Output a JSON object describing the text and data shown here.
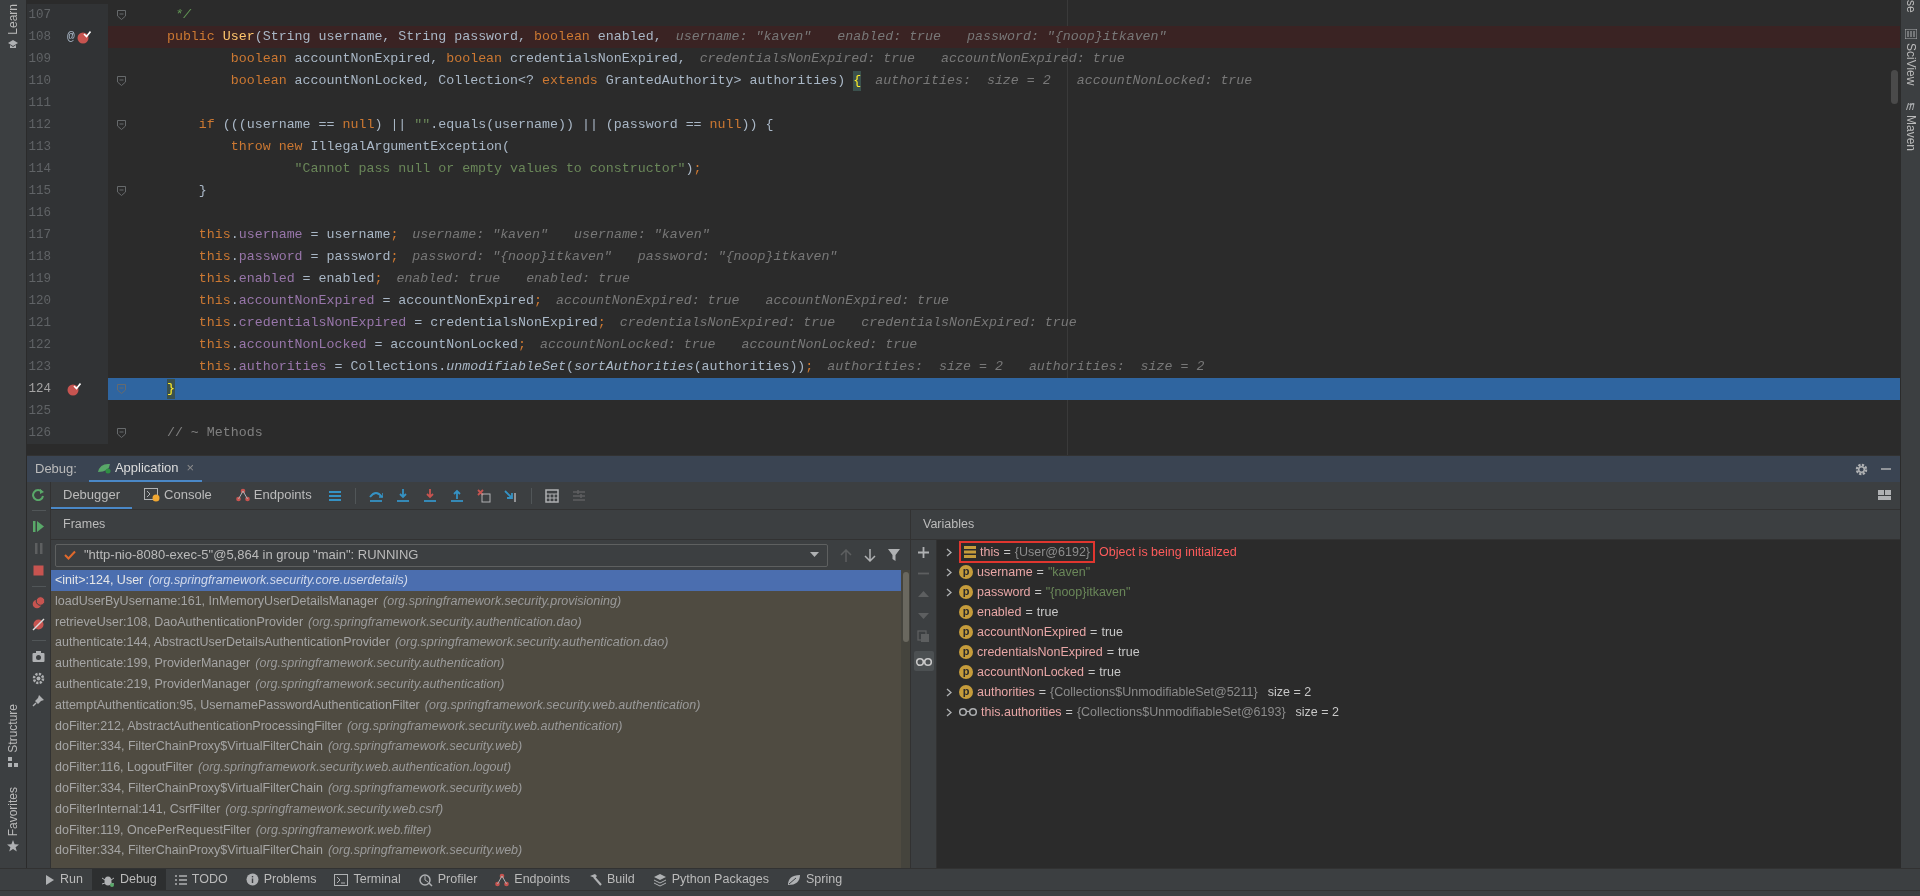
{
  "left_strip": [
    {
      "label": "Learn"
    },
    {
      "label": "Structure"
    },
    {
      "label": "Favorites"
    }
  ],
  "right_strip": [
    {
      "label": "se"
    },
    {
      "label": "SciView"
    },
    {
      "label": "Maven"
    }
  ],
  "editor": {
    "lines": [
      {
        "number": "107",
        "fold": true,
        "breakpoint": false,
        "current": false,
        "tokens": [
          {
            "t": "     */",
            "kind": "doc"
          }
        ]
      },
      {
        "number": "108",
        "mark": "@",
        "fold": false,
        "breakpoint": true,
        "current": false,
        "tokens": [
          {
            "t": "    public ",
            "kind": "kw"
          },
          {
            "t": "User",
            "kind": "fn"
          },
          {
            "t": "(String username, String password, ",
            "kind": "plain"
          },
          {
            "t": "boolean",
            "kind": "kw"
          },
          {
            "t": " enabled,",
            "kind": "plain"
          }
        ],
        "hints": [
          "username: \"kaven\"",
          "enabled: true",
          "password: \"{noop}itkaven\""
        ]
      },
      {
        "number": "109",
        "fold": false,
        "breakpoint": false,
        "current": false,
        "tokens": [
          {
            "t": "            boolean",
            "kind": "kw"
          },
          {
            "t": " accountNonExpired, ",
            "kind": "plain"
          },
          {
            "t": "boolean",
            "kind": "kw"
          },
          {
            "t": " credentialsNonExpired,",
            "kind": "plain"
          }
        ],
        "hints": [
          "credentialsNonExpired: true",
          "accountNonExpired: true"
        ]
      },
      {
        "number": "110",
        "fold": true,
        "breakpoint": false,
        "current": false,
        "tokens": [
          {
            "t": "            boolean",
            "kind": "kw"
          },
          {
            "t": " accountNonLocked, Collection<? ",
            "kind": "plain"
          },
          {
            "t": "extends",
            "kind": "kw"
          },
          {
            "t": " GrantedAuthority> authorities) ",
            "kind": "plain"
          },
          {
            "t": "{",
            "kind": "brace"
          }
        ],
        "hints": [
          "authorities:  size = 2",
          "accountNonLocked: true"
        ]
      },
      {
        "number": "111",
        "fold": false,
        "breakpoint": false,
        "current": false
      },
      {
        "number": "112",
        "fold": true,
        "breakpoint": false,
        "current": false,
        "tokens": [
          {
            "t": "        if",
            "kind": "kw"
          },
          {
            "t": " (((username == ",
            "kind": "plain"
          },
          {
            "t": "null",
            "kind": "kw"
          },
          {
            "t": ") || ",
            "kind": "plain"
          },
          {
            "t": "\"\"",
            "kind": "str"
          },
          {
            "t": ".equals(username)) || (password == ",
            "kind": "plain"
          },
          {
            "t": "null",
            "kind": "kw"
          },
          {
            "t": ")) {",
            "kind": "plain"
          }
        ]
      },
      {
        "number": "113",
        "fold": false,
        "breakpoint": false,
        "current": false,
        "tokens": [
          {
            "t": "            throw new",
            "kind": "kw"
          },
          {
            "t": " IllegalArgumentException(",
            "kind": "plain"
          }
        ]
      },
      {
        "number": "114",
        "fold": false,
        "breakpoint": false,
        "current": false,
        "tokens": [
          {
            "t": "                    \"Cannot pass null or empty values to constructor\"",
            "kind": "str"
          },
          {
            "t": ")",
            "kind": "plain"
          },
          {
            "t": ";",
            "kind": "kw"
          }
        ]
      },
      {
        "number": "115",
        "fold": true,
        "breakpoint": false,
        "current": false,
        "tokens": [
          {
            "t": "        }",
            "kind": "plain"
          }
        ]
      },
      {
        "number": "116",
        "fold": false,
        "breakpoint": false,
        "current": false
      },
      {
        "number": "117",
        "fold": false,
        "breakpoint": false,
        "current": false,
        "tokens": [
          {
            "t": "        this",
            "kind": "kw"
          },
          {
            "t": ".",
            "kind": "plain"
          },
          {
            "t": "username",
            "kind": "field"
          },
          {
            "t": " = username",
            "kind": "plain"
          },
          {
            "t": ";",
            "kind": "kw"
          }
        ],
        "hints": [
          "username: \"kaven\"",
          "username: \"kaven\""
        ]
      },
      {
        "number": "118",
        "fold": false,
        "breakpoint": false,
        "current": false,
        "tokens": [
          {
            "t": "        this",
            "kind": "kw"
          },
          {
            "t": ".",
            "kind": "plain"
          },
          {
            "t": "password",
            "kind": "field"
          },
          {
            "t": " = password",
            "kind": "plain"
          },
          {
            "t": ";",
            "kind": "kw"
          }
        ],
        "hints": [
          "password: \"{noop}itkaven\"",
          "password: \"{noop}itkaven\""
        ]
      },
      {
        "number": "119",
        "fold": false,
        "breakpoint": false,
        "current": false,
        "tokens": [
          {
            "t": "        this",
            "kind": "kw"
          },
          {
            "t": ".",
            "kind": "plain"
          },
          {
            "t": "enabled",
            "kind": "field"
          },
          {
            "t": " = enabled",
            "kind": "plain"
          },
          {
            "t": ";",
            "kind": "kw"
          }
        ],
        "hints": [
          "enabled: true",
          "enabled: true"
        ]
      },
      {
        "number": "120",
        "fold": false,
        "breakpoint": false,
        "current": false,
        "tokens": [
          {
            "t": "        this",
            "kind": "kw"
          },
          {
            "t": ".",
            "kind": "plain"
          },
          {
            "t": "accountNonExpired",
            "kind": "field"
          },
          {
            "t": " = accountNonExpired",
            "kind": "plain"
          },
          {
            "t": ";",
            "kind": "kw"
          }
        ],
        "hints": [
          "accountNonExpired: true",
          "accountNonExpired: true"
        ]
      },
      {
        "number": "121",
        "fold": false,
        "breakpoint": false,
        "current": false,
        "tokens": [
          {
            "t": "        this",
            "kind": "kw"
          },
          {
            "t": ".",
            "kind": "plain"
          },
          {
            "t": "credentialsNonExpired",
            "kind": "field"
          },
          {
            "t": " = credentialsNonExpired",
            "kind": "plain"
          },
          {
            "t": ";",
            "kind": "kw"
          }
        ],
        "hints": [
          "credentialsNonExpired: true",
          "credentialsNonExpired: true"
        ]
      },
      {
        "number": "122",
        "fold": false,
        "breakpoint": false,
        "current": false,
        "tokens": [
          {
            "t": "        this",
            "kind": "kw"
          },
          {
            "t": ".",
            "kind": "plain"
          },
          {
            "t": "accountNonLocked",
            "kind": "field"
          },
          {
            "t": " = accountNonLocked",
            "kind": "plain"
          },
          {
            "t": ";",
            "kind": "kw"
          }
        ],
        "hints": [
          "accountNonLocked: true",
          "accountNonLocked: true"
        ]
      },
      {
        "number": "123",
        "fold": false,
        "breakpoint": false,
        "current": false,
        "tokens": [
          {
            "t": "        this",
            "kind": "kw"
          },
          {
            "t": ".",
            "kind": "plain"
          },
          {
            "t": "authorities",
            "kind": "field"
          },
          {
            "t": " = Collections.",
            "kind": "plain"
          },
          {
            "t": "unmodifiableSet",
            "kind": "italic"
          },
          {
            "t": "(",
            "kind": "plain"
          },
          {
            "t": "sortAuthorities",
            "kind": "italic"
          },
          {
            "t": "(authorities))",
            "kind": "plain"
          },
          {
            "t": ";",
            "kind": "kw"
          }
        ],
        "hints": [
          "authorities:  size = 2",
          "authorities:  size = 2"
        ]
      },
      {
        "number": "124",
        "fold": true,
        "breakpoint": true,
        "current": true,
        "tokens": [
          {
            "t": "    }",
            "kind": "brace"
          }
        ]
      },
      {
        "number": "125",
        "fold": false,
        "breakpoint": false,
        "current": false
      },
      {
        "number": "126",
        "fold": true,
        "breakpoint": false,
        "current": false,
        "tokens": [
          {
            "t": "    // ~ Methods",
            "kind": "comment"
          }
        ]
      }
    ]
  },
  "debug": {
    "title": "Debug:",
    "session": {
      "label": "Application",
      "selected": true,
      "close": "×"
    },
    "tabs": [
      {
        "label": "Debugger",
        "selected": true
      },
      {
        "label": "Console",
        "selected": false
      },
      {
        "label": "Endpoints",
        "selected": false
      }
    ],
    "frames": {
      "title": "Frames",
      "thread": "\"http-nio-8080-exec-5\"@5,864 in group \"main\": RUNNING",
      "items": [
        {
          "method": "<init>:124, User",
          "package": "(org.springframework.security.core.userdetails)",
          "selected": true
        },
        {
          "method": "loadUserByUsername:161, InMemoryUserDetailsManager",
          "package": "(org.springframework.security.provisioning)",
          "selected": false
        },
        {
          "method": "retrieveUser:108, DaoAuthenticationProvider",
          "package": "(org.springframework.security.authentication.dao)",
          "selected": false
        },
        {
          "method": "authenticate:144, AbstractUserDetailsAuthenticationProvider",
          "package": "(org.springframework.security.authentication.dao)",
          "selected": false
        },
        {
          "method": "authenticate:199, ProviderManager",
          "package": "(org.springframework.security.authentication)",
          "selected": false
        },
        {
          "method": "authenticate:219, ProviderManager",
          "package": "(org.springframework.security.authentication)",
          "selected": false
        },
        {
          "method": "attemptAuthentication:95, UsernamePasswordAuthenticationFilter",
          "package": "(org.springframework.security.web.authentication)",
          "selected": false
        },
        {
          "method": "doFilter:212, AbstractAuthenticationProcessingFilter",
          "package": "(org.springframework.security.web.authentication)",
          "selected": false
        },
        {
          "method": "doFilter:334, FilterChainProxy$VirtualFilterChain",
          "package": "(org.springframework.security.web)",
          "selected": false
        },
        {
          "method": "doFilter:116, LogoutFilter",
          "package": "(org.springframework.security.web.authentication.logout)",
          "selected": false
        },
        {
          "method": "doFilter:334, FilterChainProxy$VirtualFilterChain",
          "package": "(org.springframework.security.web)",
          "selected": false
        },
        {
          "method": "doFilterInternal:141, CsrfFilter",
          "package": "(org.springframework.security.web.csrf)",
          "selected": false
        },
        {
          "method": "doFilter:119, OncePerRequestFilter",
          "package": "(org.springframework.web.filter)",
          "selected": false
        },
        {
          "method": "doFilter:334, FilterChainProxy$VirtualFilterChain",
          "package": "(org.springframework.security.web)",
          "selected": false
        }
      ]
    },
    "variables": {
      "title": "Variables",
      "items": [
        {
          "kind": "object",
          "expandable": true,
          "boxed": true,
          "name": "this",
          "op": "=",
          "value": {
            "text": "{User@6192}",
            "kind": "ref"
          },
          "note": "Object is being initialized"
        },
        {
          "kind": "param",
          "badge": "p",
          "expandable": true,
          "boxed": false,
          "name": "username",
          "op": "=",
          "value": {
            "text": "\"kaven\"",
            "kind": "string"
          }
        },
        {
          "kind": "param",
          "badge": "p",
          "expandable": true,
          "boxed": false,
          "name": "password",
          "op": "=",
          "value": {
            "text": "\"{noop}itkaven\"",
            "kind": "string"
          }
        },
        {
          "kind": "param",
          "badge": "p",
          "expandable": false,
          "boxed": false,
          "name": "enabled",
          "op": "=",
          "value": {
            "text": "true",
            "kind": "literal"
          }
        },
        {
          "kind": "param",
          "badge": "p",
          "expandable": false,
          "boxed": false,
          "name": "accountNonExpired",
          "op": "=",
          "value": {
            "text": "true",
            "kind": "literal"
          }
        },
        {
          "kind": "param",
          "badge": "p",
          "expandable": false,
          "boxed": false,
          "name": "credentialsNonExpired",
          "op": "=",
          "value": {
            "text": "true",
            "kind": "literal"
          }
        },
        {
          "kind": "param",
          "badge": "p",
          "expandable": false,
          "boxed": false,
          "name": "accountNonLocked",
          "op": "=",
          "value": {
            "text": "true",
            "kind": "literal"
          }
        },
        {
          "kind": "param",
          "badge": "p",
          "expandable": true,
          "boxed": false,
          "name": "authorities",
          "op": "=",
          "value": {
            "text": "{Collections$UnmodifiableSet@5211}",
            "kind": "ref"
          },
          "extra": "size = 2"
        },
        {
          "kind": "watch",
          "expandable": true,
          "boxed": false,
          "name": "this.authorities",
          "op": "=",
          "value": {
            "text": "{Collections$UnmodifiableSet@6193}",
            "kind": "ref"
          },
          "extra": "size = 2"
        }
      ]
    }
  },
  "bottom_bar": [
    {
      "label": "Run",
      "selected": false
    },
    {
      "label": "Debug",
      "selected": true
    },
    {
      "label": "TODO",
      "selected": false
    },
    {
      "label": "Problems",
      "selected": false
    },
    {
      "label": "Terminal",
      "selected": false
    },
    {
      "label": "Profiler",
      "selected": false
    },
    {
      "label": "Endpoints",
      "selected": false
    },
    {
      "label": "Build",
      "selected": false
    },
    {
      "label": "Python Packages",
      "selected": false
    },
    {
      "label": "Spring",
      "selected": false
    }
  ]
}
